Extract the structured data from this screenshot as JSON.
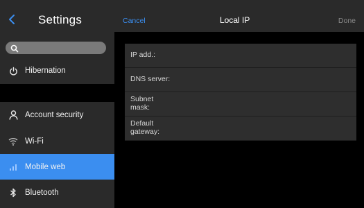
{
  "sidebar": {
    "title": "Settings",
    "search": {
      "placeholder": "",
      "value": ""
    },
    "items": [
      {
        "label": "Hibernation",
        "icon": "power-icon"
      },
      {
        "label": "Account security",
        "icon": "person-icon"
      },
      {
        "label": "Wi-Fi",
        "icon": "wifi-icon"
      },
      {
        "label": "Mobile web",
        "icon": "signal-bars-icon",
        "selected": true
      },
      {
        "label": "Bluetooth",
        "icon": "bluetooth-icon"
      }
    ]
  },
  "topbar": {
    "cancel_label": "Cancel",
    "title": "Local IP",
    "done_label": "Done"
  },
  "form": {
    "fields": [
      {
        "label": "IP add.:",
        "value": ""
      },
      {
        "label": "DNS server:",
        "value": ""
      },
      {
        "label": "Subnet mask:",
        "value": ""
      },
      {
        "label": "Default gateway:",
        "value": ""
      }
    ]
  },
  "colors": {
    "accent": "#3b8ef0",
    "sidebar_bg": "#2a2a2a",
    "row_bg": "#2e2e2e",
    "background": "#000000",
    "done_disabled": "#8a8a8a"
  }
}
